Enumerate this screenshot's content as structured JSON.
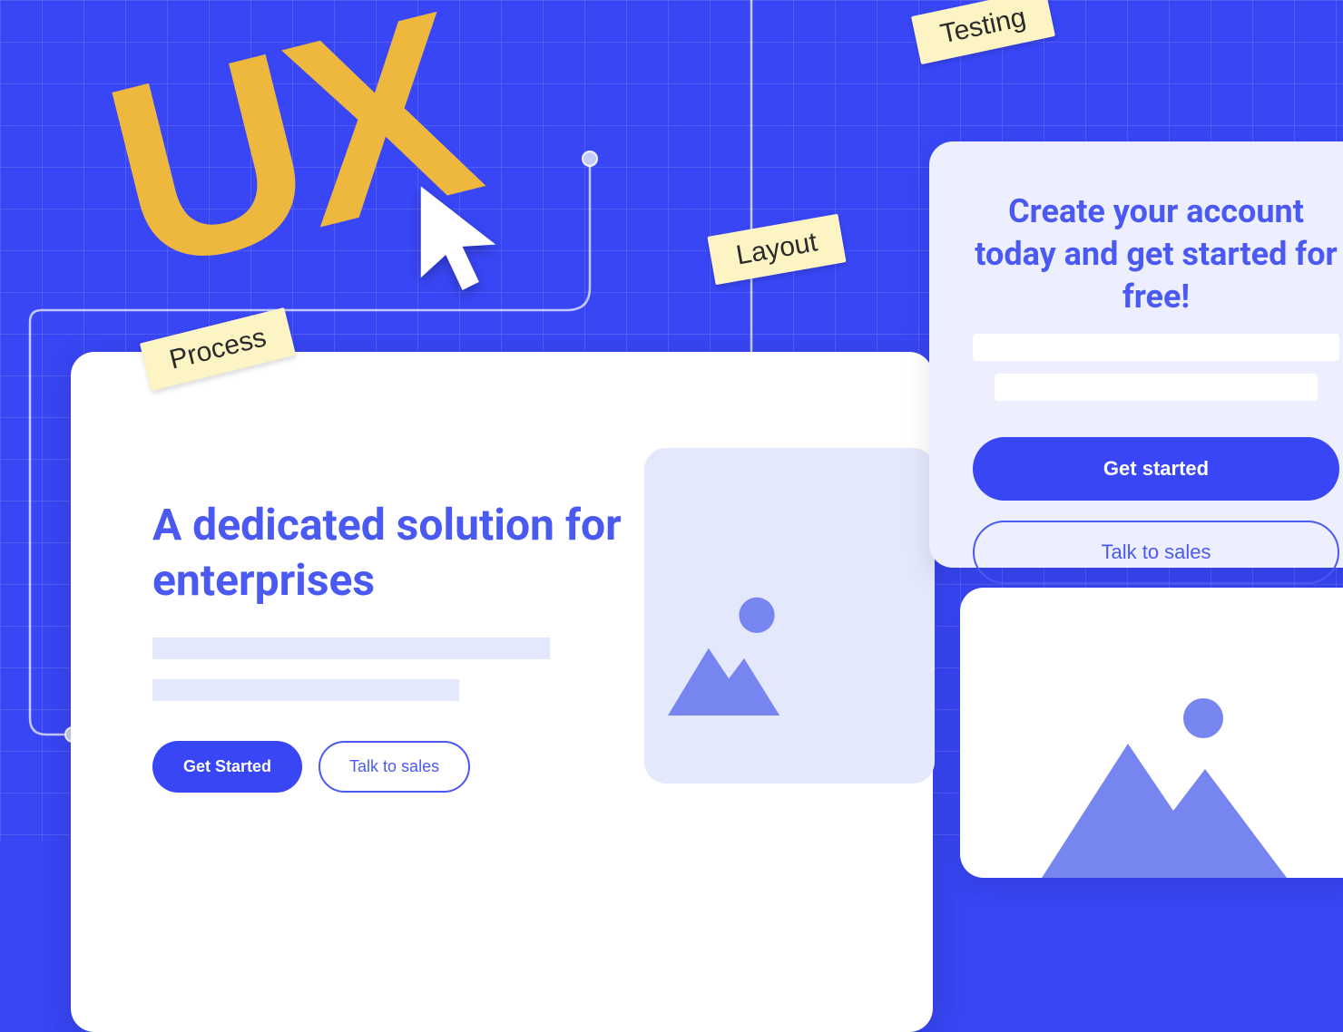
{
  "decor": {
    "ux_label": "UX",
    "sticky_testing": "Testing",
    "sticky_layout": "Layout",
    "sticky_process": "Process"
  },
  "left_card": {
    "heading": "A dedicated solution for enterprises",
    "cta_primary": "Get Started",
    "cta_secondary": "Talk to sales"
  },
  "right_card_top": {
    "heading": "Create your account today and get started for free!",
    "cta_primary": "Get started",
    "cta_secondary": "Talk to sales"
  }
}
